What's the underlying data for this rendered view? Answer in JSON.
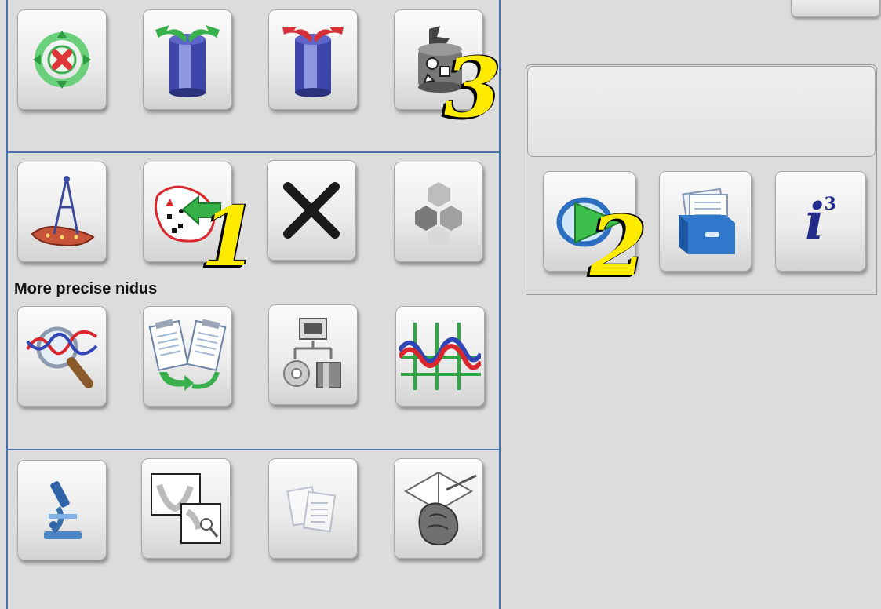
{
  "left_panel": {
    "section_label": "More precise nidus"
  },
  "toolbar_icons": {
    "row1": [
      "target-arrows-icon",
      "cylinder-green-arrows-icon",
      "cylinder-red-arrows-icon",
      "cylinder-shapes-icon"
    ],
    "row2": [
      "compass-measure-icon",
      "region-points-arrow-icon",
      "close-x-icon",
      "hexagon-cluster-icon"
    ],
    "row3": [
      "waveform-magnifier-icon",
      "document-swap-icon",
      "export-workflow-icon",
      "waveform-grid-icon"
    ],
    "row4": [
      "microscope-icon",
      "image-compare-icon",
      "clipboard-notes-icon",
      "heart-slices-icon"
    ]
  },
  "right_panel": {
    "buttons": [
      "play-circle-icon",
      "file-box-icon",
      "info-i3-icon"
    ],
    "info_icon_text": "i",
    "info_icon_sup": "3"
  },
  "callouts": [
    "1",
    "2",
    "3"
  ],
  "colors": {
    "panel_border": "#4a6fa5",
    "callout_fill": "#ffeb00",
    "background": "#dcdcdc"
  }
}
